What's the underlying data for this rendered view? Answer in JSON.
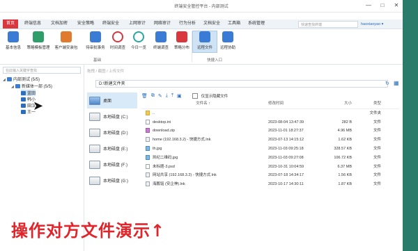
{
  "window": {
    "title": "终端安全管控平台 - 内部测试"
  },
  "menu": {
    "items": [
      "首页",
      "终端信息",
      "文档加密",
      "安全策略",
      "终端安全",
      "上网审计",
      "网络审计",
      "行为分析",
      "文档安全",
      "工具箱",
      "系统管理"
    ],
    "active": "首页",
    "search_placeholder": "快速查找终端",
    "user": "haoxiaoyao"
  },
  "ribbon": {
    "buttons": [
      {
        "label": "基本信息",
        "icon": "user-info-icon",
        "color": "#3a7bd5"
      },
      {
        "label": "策略模板管理",
        "icon": "template-icon",
        "color": "#2f9e6a"
      },
      {
        "label": "客户端安装包",
        "icon": "package-icon",
        "color": "#e07a2c"
      },
      {
        "label": "待审批事务",
        "icon": "approval-icon",
        "color": "#3a7bd5"
      },
      {
        "label": "时间调查",
        "icon": "clock-icon",
        "color": "#d9363e"
      },
      {
        "label": "今日一览",
        "icon": "eye-icon",
        "color": "#2aa6a1"
      },
      {
        "label": "终端调查",
        "icon": "terminal-icon",
        "color": "#3a7bd5"
      },
      {
        "label": "策略分布",
        "icon": "distribution-icon",
        "color": "#d9363e"
      },
      {
        "label": "远程文件",
        "icon": "remote-file-icon",
        "color": "#3a7bd5"
      },
      {
        "label": "远程协助",
        "icon": "remote-assist-icon",
        "color": "#3a7bd5"
      }
    ],
    "selected": "远程文件",
    "groups": [
      "基础",
      "快捷入口"
    ]
  },
  "sidebar": {
    "search_placeholder": "在此输入关键字查找",
    "tree": [
      {
        "label": "内部测试 (5/5)",
        "level": 0
      },
      {
        "label": "新媒体一部 (5/5)",
        "level": 1
      },
      {
        "label": "蓝田",
        "level": 2
      },
      {
        "label": "韩小",
        "level": 2
      },
      {
        "label": "田汉",
        "level": 2
      },
      {
        "label": "王一",
        "level": 2
      }
    ],
    "selected": "蓝田"
  },
  "right": {
    "hint": "拖拽 / 截图 / 上传文件",
    "path": "D:\\新建文件夹",
    "drives": [
      "桌面",
      "本地磁盘 (C:)",
      "本地磁盘 (D:)",
      "本地磁盘 (E:)",
      "本地磁盘 (F:)",
      "本地磁盘 (G:)"
    ],
    "active_drive": "桌面",
    "show_hidden_label": "仅显示隐藏文件",
    "columns": {
      "name": "文件名 ↑",
      "date": "修改时间",
      "size": "大小",
      "type": "类型"
    },
    "files": [
      {
        "name": "..",
        "date": "",
        "size": "",
        "type": "文件夹",
        "icon": "folder"
      },
      {
        "name": "desktop.ini",
        "date": "2023-08-04 13:47:39",
        "size": "282 B",
        "type": "文件",
        "icon": "file"
      },
      {
        "name": "download.zip",
        "date": "2023-11-01 18:27:37",
        "size": "4.96 MB",
        "type": "文件",
        "icon": "zip"
      },
      {
        "name": "home (192.168.3.2) - 快捷方式.lnk",
        "date": "2023-07-13 14:15:12",
        "size": "1.62 KB",
        "type": "文件",
        "icon": "lnk"
      },
      {
        "name": "th.jpg",
        "date": "2023-11-03 09:25:18",
        "size": "328.57 KB",
        "type": "文件",
        "icon": "img"
      },
      {
        "name": "凯纪二维码.jpg",
        "date": "2023-11-03 09:27:08",
        "size": "106.72 KB",
        "type": "文件",
        "icon": "img"
      },
      {
        "name": "未标题-3.psd",
        "date": "2023-10-31 10:04:59",
        "size": "6.37 MB",
        "type": "文件",
        "icon": "file"
      },
      {
        "name": "网站共享 (192.168.3.2) - 快捷方式.lnk",
        "date": "2023-07-18 14:34:17",
        "size": "1.56 KB",
        "type": "文件",
        "icon": "lnk"
      },
      {
        "name": "海鹏铭 (安企神).lnk",
        "date": "2023-10-17 14:30:11",
        "size": "1.87 KB",
        "type": "文件",
        "icon": "lnk"
      }
    ]
  },
  "caption": "操作对方文件演示↑"
}
